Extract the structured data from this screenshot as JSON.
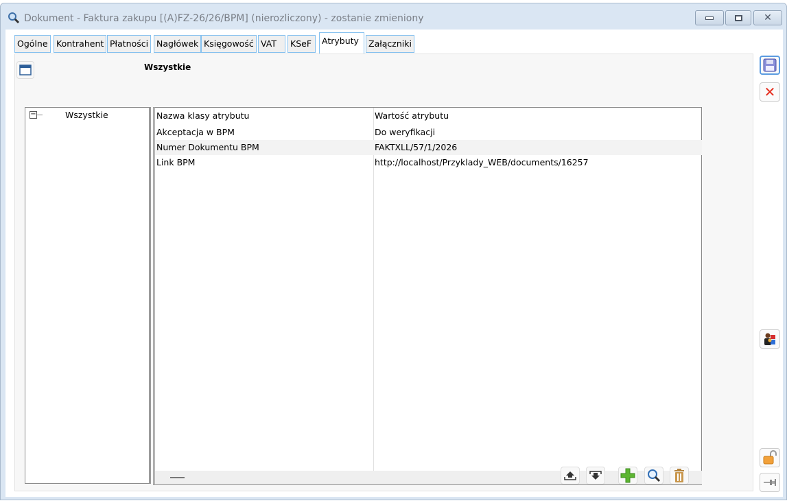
{
  "window": {
    "title": "Dokument - Faktura zakupu [(A)FZ-26/26/BPM] (nierozliczony) - zostanie zmieniony"
  },
  "tabs": [
    {
      "label": "Ogólne"
    },
    {
      "label": "Kontrahent"
    },
    {
      "label": "Płatności"
    },
    {
      "label": "Nagłówek"
    },
    {
      "label": "Księgowość"
    },
    {
      "label": "VAT"
    },
    {
      "label": "KSeF"
    },
    {
      "label": "Atrybuty",
      "active": true
    },
    {
      "label": "Załączniki"
    }
  ],
  "section_title": "Wszystkie",
  "tree": {
    "root": "Wszystkie"
  },
  "grid": {
    "headers": [
      "Nazwa klasy atrybutu",
      "Wartość atrybutu"
    ],
    "rows": [
      [
        "Akceptacja w BPM",
        "Do weryfikacji"
      ],
      [
        "Numer Dokumentu BPM",
        "FAKTXLL/57/1/2026"
      ],
      [
        "Link BPM",
        "http://localhost/Przyklady_WEB/documents/16257"
      ]
    ]
  },
  "colors": {
    "tab_border": "#86c1ef",
    "window_bg": "#dae6f3",
    "selected_row": "#f3f3f3"
  }
}
